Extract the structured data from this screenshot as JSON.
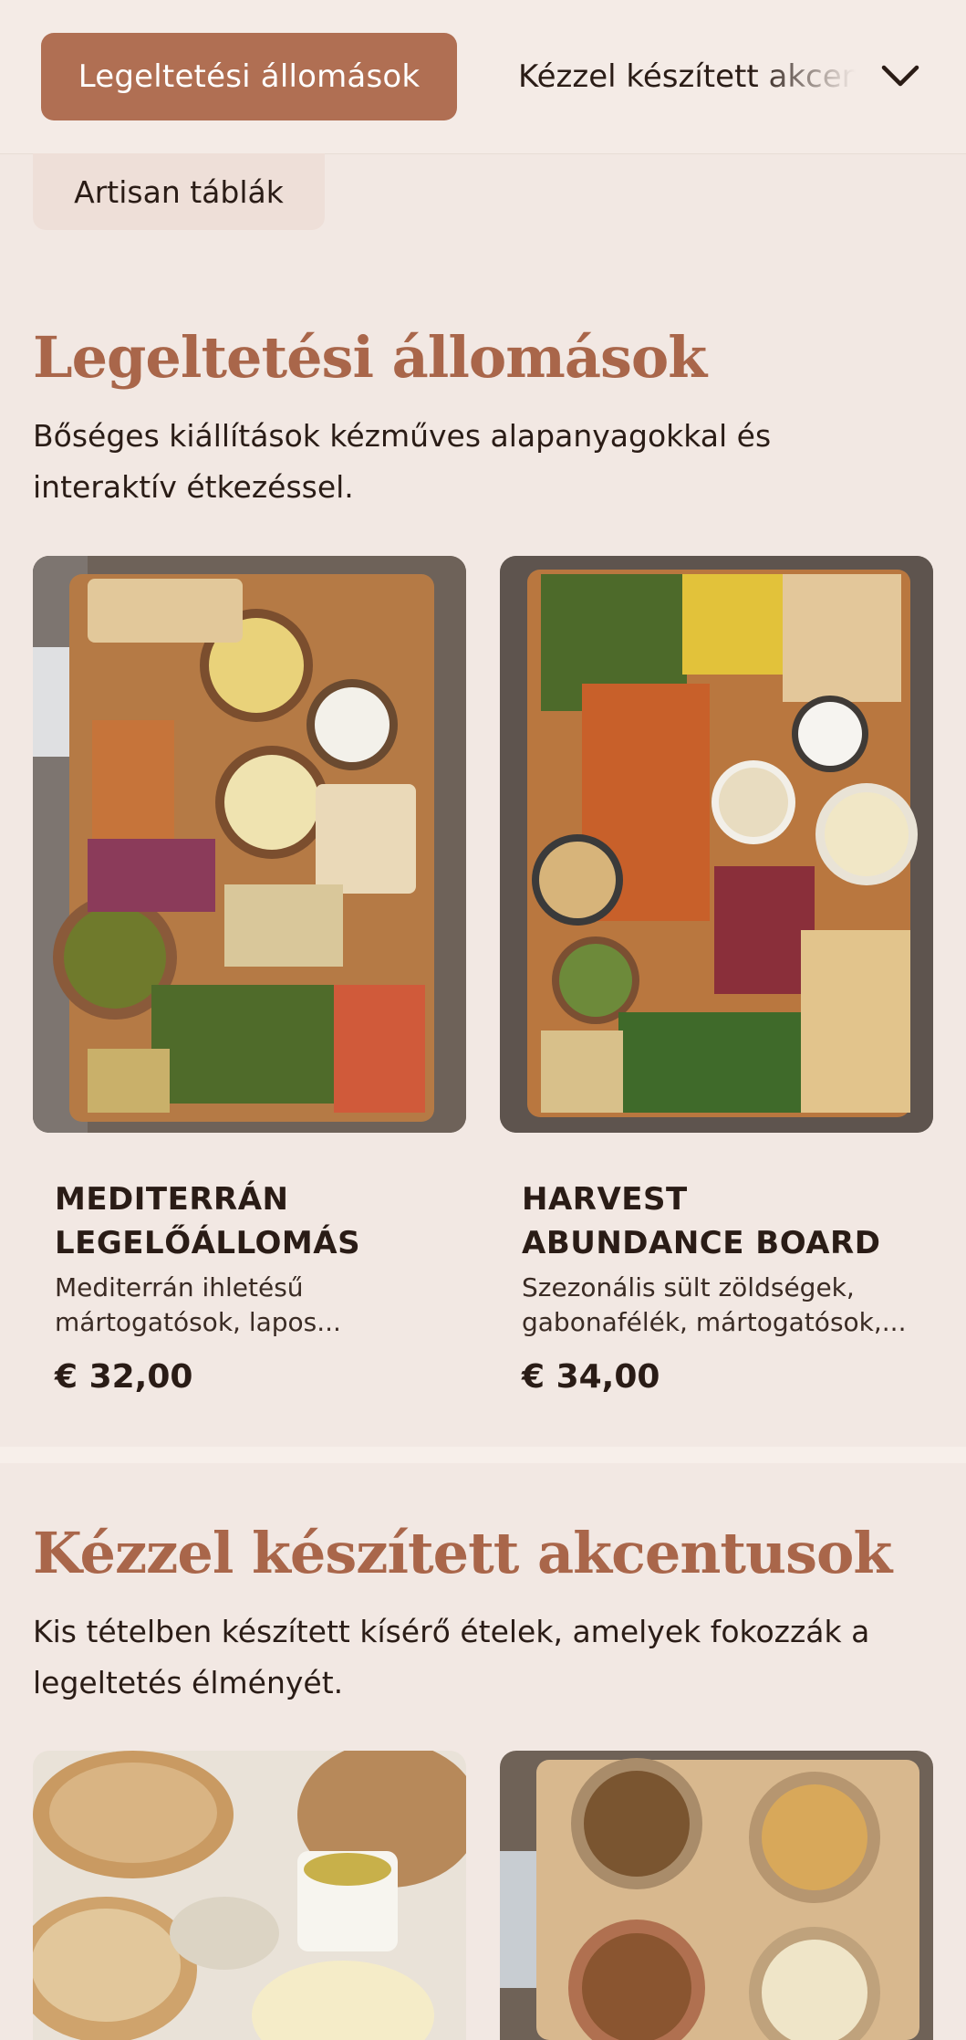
{
  "nav": {
    "active_tab": "Legeltetési állomások",
    "next_tab": "Kézzel készített akcentusok",
    "second_row_tab": "Artisan táblák",
    "dropdown_icon": "chevron-down-icon"
  },
  "sections": [
    {
      "title": "Legeltetési állomások",
      "description": "Bőséges kiállítások kézműves alapanyagokkal és interaktív étkezéssel.",
      "items": [
        {
          "name": "MEDITERRÁN LEGELŐÁLLOMÁS",
          "description": "Mediterrán ihletésű mártogatósok, lapos...",
          "price": "€ 32,00",
          "image": "mediterranean-grazing-board-photo"
        },
        {
          "name": "HARVEST ABUNDANCE BOARD",
          "description": "Szezonális sült zöldségek, gabonafélék, mártogatósok,...",
          "price": "€ 34,00",
          "image": "harvest-vegetable-board-photo"
        }
      ]
    },
    {
      "title": "Kézzel készített akcentusok",
      "description": "Kis tételben készített kísérő ételek, amelyek fokozzák a legeltetés élményét.",
      "items": [
        {
          "image": "artisan-bread-butter-photo"
        },
        {
          "image": "nut-bowls-photo"
        }
      ]
    }
  ],
  "colors": {
    "accent": "#b06f53",
    "heading": "#a9664a",
    "background": "#f2e8e3",
    "text": "#2a1c16"
  }
}
